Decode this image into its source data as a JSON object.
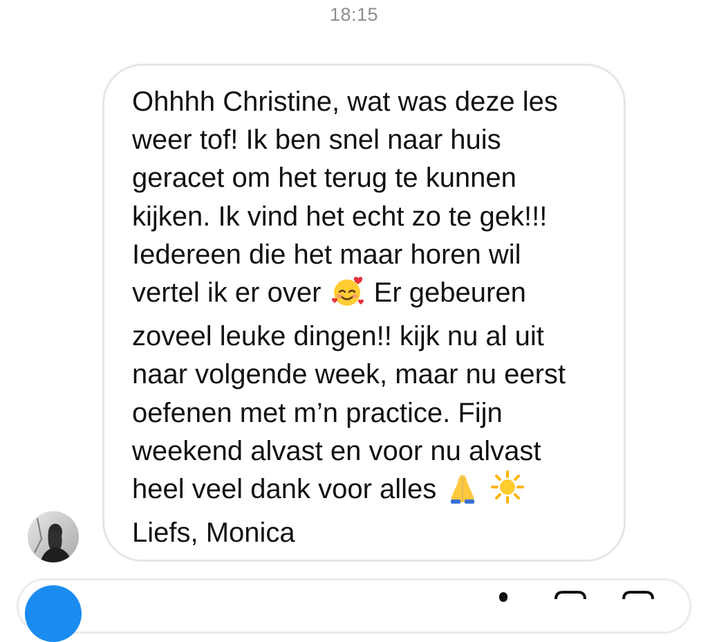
{
  "chat": {
    "timestamp": "18:15"
  },
  "message": {
    "sender_name": "Monica",
    "lines": [
      "Ohhhh Christine, wat was deze les",
      "weer tof! Ik ben snel naar huis",
      "geracet om het terug te kunnen",
      "kijken. Ik vind het echt zo te gek!!!",
      "Iedereen die het maar horen wil",
      "Er gebeuren",
      "zoveel leuke dingen!! kijk nu al uit",
      "naar volgende week, maar nu eerst",
      "oefenen met m’n practice. Fijn",
      "weekend alvast en voor nu alvast",
      "heel veel dank voor alles",
      "Liefs, Monica"
    ],
    "line6_prefix": "vertel ik er over",
    "emojis": [
      "smiling-face-with-hearts",
      "folded-hands",
      "sun"
    ]
  },
  "colors": {
    "timestamp": "#8e8e8e",
    "bubble_border": "#e6e6e6",
    "text": "#111111",
    "accent": "#1a8cf0"
  }
}
